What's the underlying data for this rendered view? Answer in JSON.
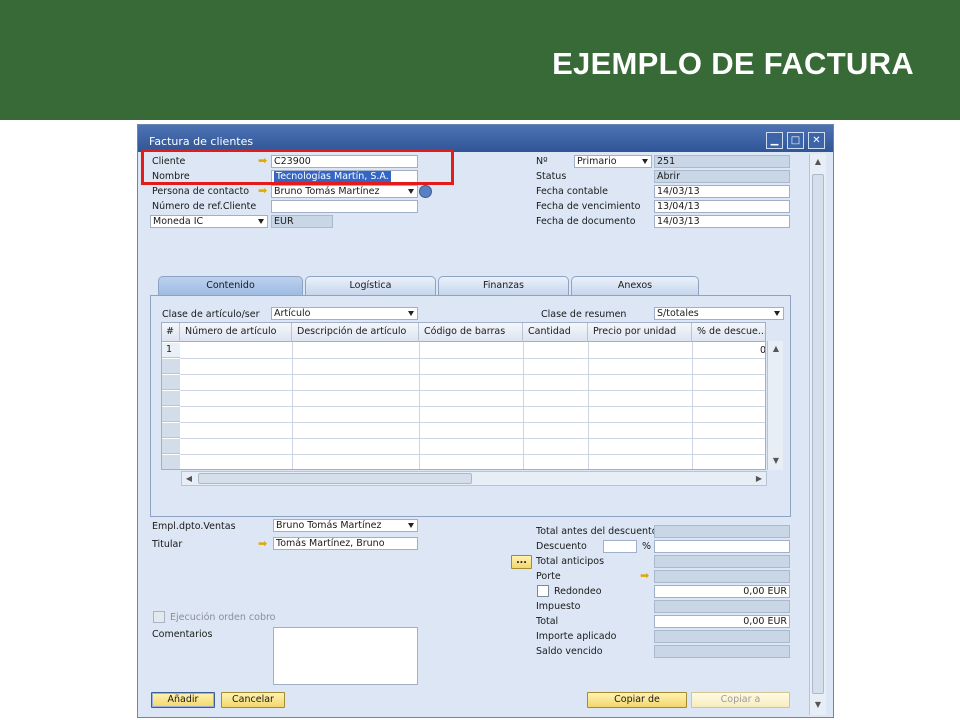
{
  "banner": {
    "title": "EJEMPLO DE FACTURA"
  },
  "window": {
    "title": "Factura de clientes"
  },
  "header_left": {
    "cliente": {
      "label": "Cliente",
      "value": "C23900"
    },
    "nombre": {
      "label": "Nombre",
      "value": "Tecnologías Martín, S.A."
    },
    "persona": {
      "label": "Persona de contacto",
      "value": "Bruno Tomás Martínez"
    },
    "ref": {
      "label": "Número de ref.Cliente",
      "value": ""
    },
    "moneda": {
      "label": "Moneda IC",
      "value": "EUR"
    }
  },
  "header_right": {
    "no": {
      "label": "Nº",
      "series": "Primario",
      "value": "251"
    },
    "status": {
      "label": "Status",
      "value": "Abrir"
    },
    "fecha_contable": {
      "label": "Fecha contable",
      "value": "14/03/13"
    },
    "fecha_venc": {
      "label": "Fecha de vencimiento",
      "value": "13/04/13"
    },
    "fecha_doc": {
      "label": "Fecha de documento",
      "value": "14/03/13"
    }
  },
  "tabs": [
    "Contenido",
    "Logística",
    "Finanzas",
    "Anexos"
  ],
  "content": {
    "clase_label": "Clase de artículo/ser",
    "clase_value": "Artículo",
    "resumen_label": "Clase de resumen",
    "resumen_value": "S/totales",
    "columns": [
      "#",
      "Número de artículo",
      "Descripción de artículo",
      "Código de barras",
      "Cantidad",
      "Precio por unidad",
      "% de descue..."
    ],
    "row1": {
      "num": "1",
      "discount": "0"
    }
  },
  "footer_left": {
    "empl": {
      "label": "Empl.dpto.Ventas",
      "value": "Bruno Tomás Martínez"
    },
    "titular": {
      "label": "Titular",
      "value": "Tomás Martínez, Bruno"
    },
    "ejecucion": "Ejecución orden cobro",
    "comentarios": "Comentarios"
  },
  "totals": {
    "antes": {
      "label": "Total antes del descuento",
      "value": ""
    },
    "descuento": {
      "label": "Descuento",
      "pct": "%",
      "value": ""
    },
    "anticipos": {
      "label": "Total anticipos",
      "btn": "..."
    },
    "porte": {
      "label": "Porte"
    },
    "redondeo": {
      "label": "Redondeo",
      "value": "0,00 EUR"
    },
    "impuesto": {
      "label": "Impuesto"
    },
    "total": {
      "label": "Total",
      "value": "0,00 EUR"
    },
    "aplicado": {
      "label": "Importe aplicado"
    },
    "saldo": {
      "label": "Saldo vencido"
    }
  },
  "buttons": {
    "anadir": "Añadir",
    "cancelar": "Cancelar",
    "copiar_de": "Copiar de",
    "copiar_a": "Copiar a"
  },
  "colors": {
    "banner": "#376a36",
    "window_bg": "#dce6f4",
    "titlebar": "#2f5597",
    "highlight": "#e31b1b"
  }
}
